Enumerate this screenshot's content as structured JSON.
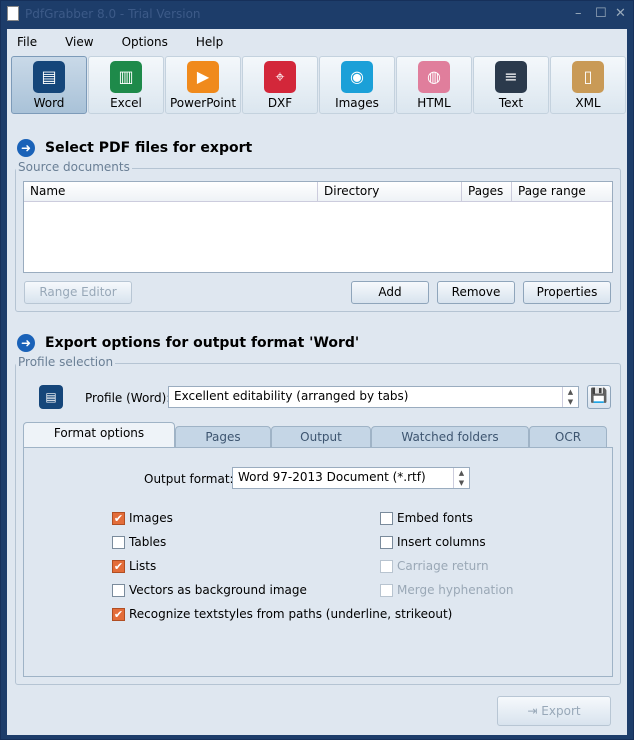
{
  "window": {
    "title": "PdfGrabber 8.0 - Trial Version"
  },
  "menu": [
    "File",
    "View",
    "Options",
    "Help"
  ],
  "formats": [
    {
      "label": "Word",
      "color": "#15467a",
      "glyph": "▤"
    },
    {
      "label": "Excel",
      "color": "#1e8a4a",
      "glyph": "▥"
    },
    {
      "label": "PowerPoint",
      "color": "#f08a1c",
      "glyph": "▶"
    },
    {
      "label": "DXF",
      "color": "#d3273a",
      "glyph": "⌖"
    },
    {
      "label": "Images",
      "color": "#1ba0d8",
      "glyph": "◉"
    },
    {
      "label": "HTML",
      "color": "#e07e9c",
      "glyph": "◍"
    },
    {
      "label": "Text",
      "color": "#2b3a4c",
      "glyph": "≡"
    },
    {
      "label": "XML",
      "color": "#c99a56",
      "glyph": "▯"
    }
  ],
  "select_section": {
    "title": "Select PDF files for export",
    "group": "Source documents",
    "columns": [
      "Name",
      "Directory",
      "Pages",
      "Page range"
    ],
    "range_editor": "Range Editor",
    "add": "Add",
    "remove": "Remove",
    "properties": "Properties"
  },
  "export_section": {
    "title": "Export options for output format 'Word'",
    "group": "Profile selection",
    "profile_label": "Profile (Word):",
    "profile_value": "Excellent editability (arranged by tabs)"
  },
  "tabs": [
    "Format options",
    "Pages",
    "Output",
    "Watched folders",
    "OCR"
  ],
  "format_options": {
    "output_format_label": "Output format:",
    "output_format_value": "Word 97-2013 Document (*.rtf)",
    "checkboxes": [
      {
        "label": "Images",
        "checked": true,
        "enabled": true
      },
      {
        "label": "Tables",
        "checked": false,
        "enabled": true
      },
      {
        "label": "Lists",
        "checked": true,
        "enabled": true
      },
      {
        "label": "Vectors as background image",
        "checked": false,
        "enabled": true
      },
      {
        "label": "Recognize textstyles from paths (underline, strikeout)",
        "checked": true,
        "enabled": true
      },
      {
        "label": "Embed fonts",
        "checked": false,
        "enabled": true
      },
      {
        "label": "Insert columns",
        "checked": false,
        "enabled": true
      },
      {
        "label": "Carriage return",
        "checked": false,
        "enabled": false
      },
      {
        "label": "Merge hyphenation",
        "checked": false,
        "enabled": false
      }
    ]
  },
  "export_button": "Export"
}
